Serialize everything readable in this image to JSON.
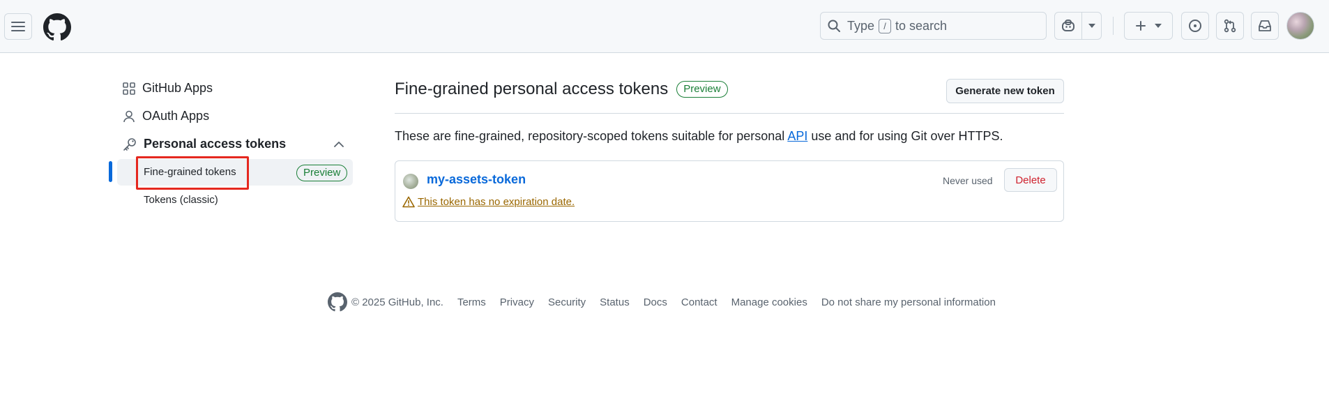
{
  "header": {
    "search_prefix": "Type",
    "search_key": "/",
    "search_suffix": "to search"
  },
  "sidebar": {
    "items": [
      {
        "label": "GitHub Apps",
        "icon": "apps-icon"
      },
      {
        "label": "OAuth Apps",
        "icon": "person-icon"
      },
      {
        "label": "Personal access tokens",
        "icon": "key-icon"
      }
    ],
    "sub_items": [
      {
        "label": "Fine-grained tokens",
        "badge": "Preview",
        "active": true
      },
      {
        "label": "Tokens (classic)"
      }
    ]
  },
  "main": {
    "title": "Fine-grained personal access tokens",
    "title_badge": "Preview",
    "generate_button": "Generate new token",
    "desc_before": "These are fine-grained, repository-scoped tokens suitable for personal ",
    "desc_link": "API",
    "desc_after": " use and for using Git over HTTPS.",
    "token": {
      "name": "my-assets-token",
      "last_used": "Never used",
      "delete_label": "Delete",
      "warning": "This token has no expiration date."
    }
  },
  "footer": {
    "copyright": "© 2025 GitHub, Inc.",
    "links": [
      "Terms",
      "Privacy",
      "Security",
      "Status",
      "Docs",
      "Contact",
      "Manage cookies",
      "Do not share my personal information"
    ]
  },
  "colors": {
    "accent": "#0969da",
    "success": "#1a7f37",
    "danger": "#cf222e",
    "attention": "#9a6700",
    "highlight_box": "#e5281f"
  }
}
